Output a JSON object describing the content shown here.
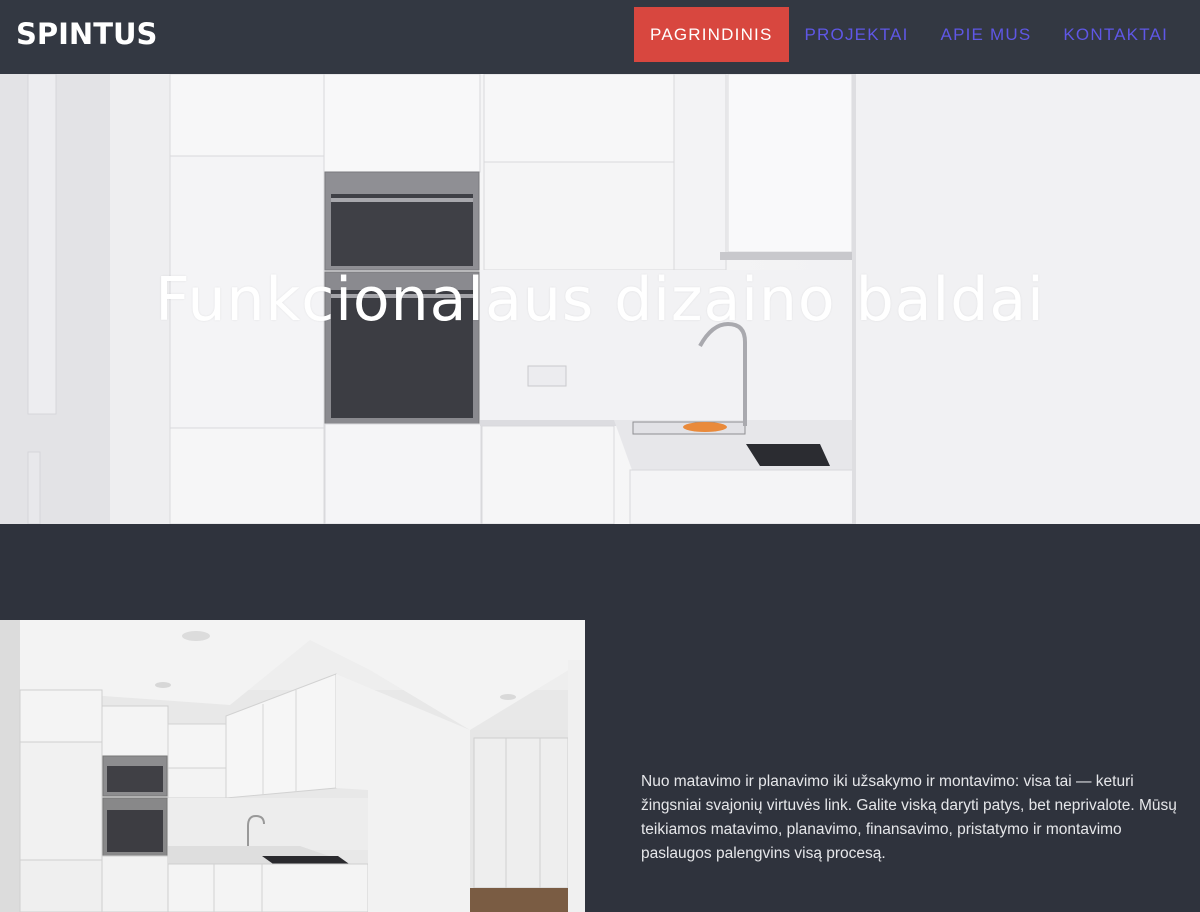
{
  "header": {
    "logo": "SPINTUS",
    "nav": [
      {
        "label": "PAGRINDINIS",
        "active": true
      },
      {
        "label": "PROJEKTAI",
        "active": false
      },
      {
        "label": "APIE MUS",
        "active": false
      },
      {
        "label": "KONTAKTAI",
        "active": false
      }
    ]
  },
  "hero": {
    "title": "Funkcionalaus dizaino baldai",
    "image": "white-kitchen-photo"
  },
  "section": {
    "image": "white-kitchen-corner-photo",
    "text": "Nuo matavimo ir planavimo iki užsakymo ir montavimo: visa tai — keturi žingsniai svajonių virtuvės link. Galite viską daryti patys, bet neprivalote. Mūsų teikiamos matavimo, planavimo, finansavimo, pristatymo ir montavimo paslaugos palengvins visą procesą."
  },
  "colors": {
    "header_bg": "#333842",
    "active_nav_bg": "#d8473f",
    "nav_link": "#5f57e6",
    "content_bg": "#2f333d"
  }
}
